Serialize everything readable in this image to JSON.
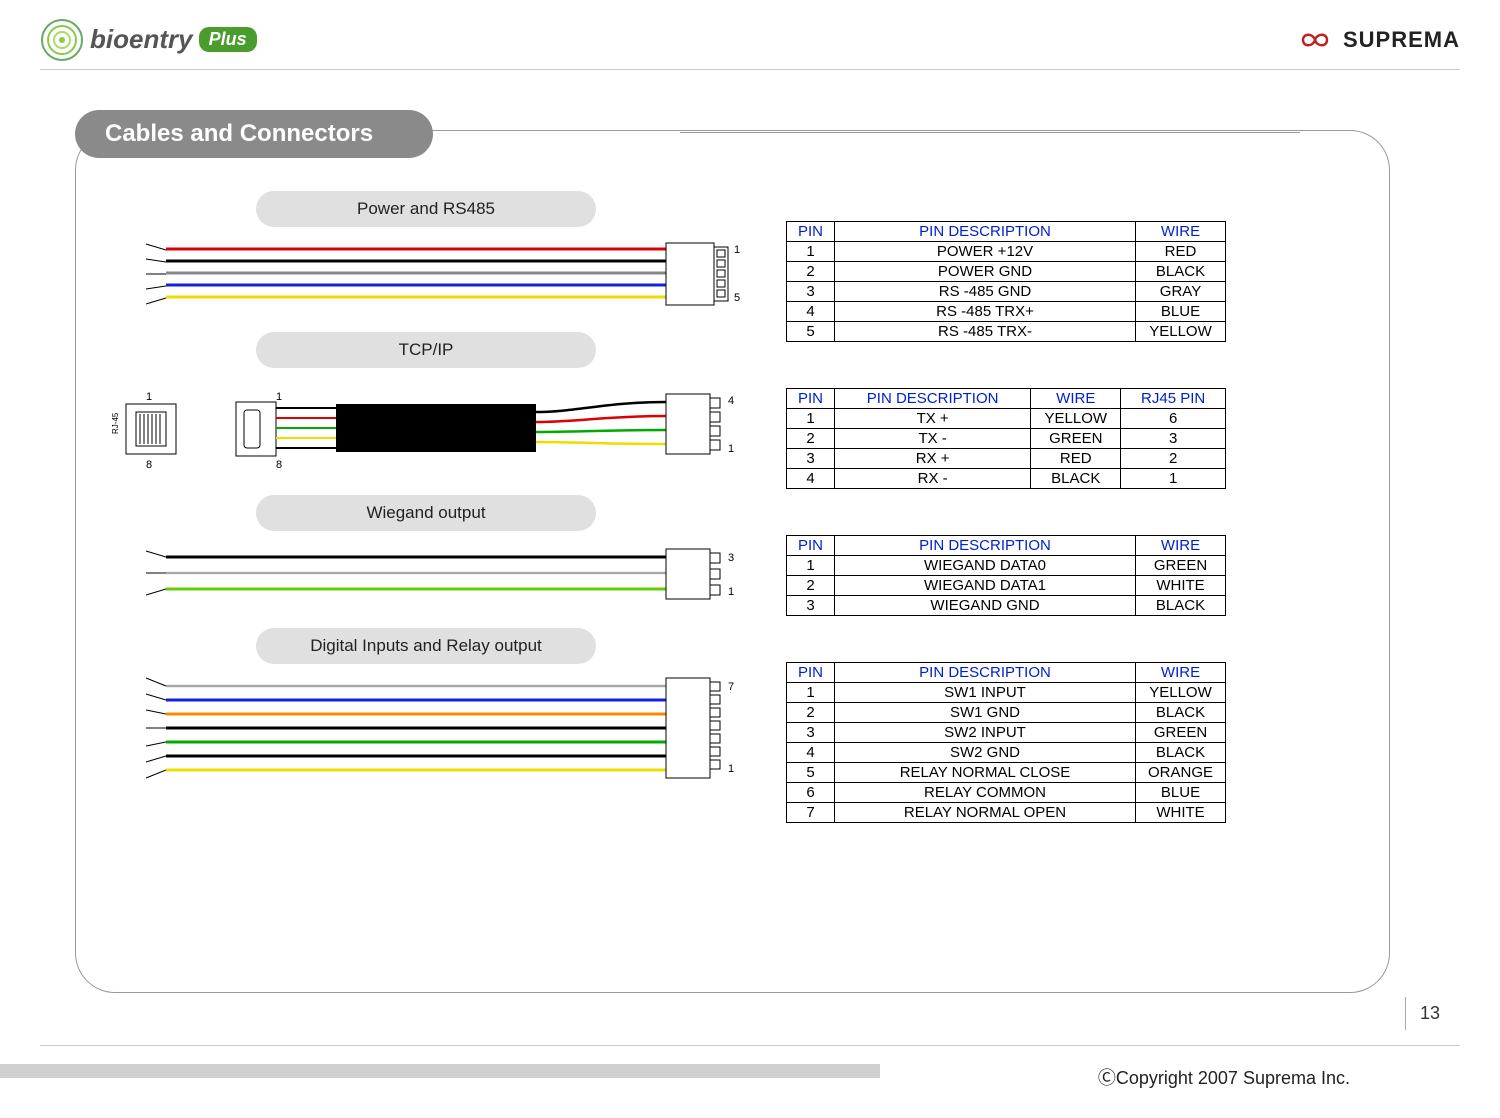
{
  "header": {
    "brand_prefix": "bioentry",
    "brand_badge": "Plus",
    "company": "SUPREMA"
  },
  "section_title": "Cables and Connectors",
  "labels": {
    "power": "Power and RS485",
    "tcpip": "TCP/IP",
    "wiegand": "Wiegand output",
    "digital": "Digital Inputs and Relay output"
  },
  "tables": {
    "headers3": {
      "pin": "PIN",
      "desc": "PIN DESCRIPTION",
      "wire": "WIRE"
    },
    "headers4": {
      "pin": "PIN",
      "desc": "PIN DESCRIPTION",
      "wire": "WIRE",
      "rj": "RJ45 PIN"
    },
    "power": [
      {
        "pin": "1",
        "desc": "POWER +12V",
        "wire": "RED"
      },
      {
        "pin": "2",
        "desc": "POWER GND",
        "wire": "BLACK"
      },
      {
        "pin": "3",
        "desc": "RS -485 GND",
        "wire": "GRAY"
      },
      {
        "pin": "4",
        "desc": "RS -485 TRX+",
        "wire": "BLUE"
      },
      {
        "pin": "5",
        "desc": "RS -485 TRX-",
        "wire": "YELLOW"
      }
    ],
    "tcpip": [
      {
        "pin": "1",
        "desc": "TX +",
        "wire": "YELLOW",
        "rj": "6"
      },
      {
        "pin": "2",
        "desc": "TX -",
        "wire": "GREEN",
        "rj": "3"
      },
      {
        "pin": "3",
        "desc": "RX +",
        "wire": "RED",
        "rj": "2"
      },
      {
        "pin": "4",
        "desc": "RX -",
        "wire": "BLACK",
        "rj": "1"
      }
    ],
    "wiegand": [
      {
        "pin": "1",
        "desc": "WIEGAND DATA0",
        "wire": "GREEN"
      },
      {
        "pin": "2",
        "desc": "WIEGAND DATA1",
        "wire": "WHITE"
      },
      {
        "pin": "3",
        "desc": "WIEGAND GND",
        "wire": "BLACK"
      }
    ],
    "digital": [
      {
        "pin": "1",
        "desc": "SW1 INPUT",
        "wire": "YELLOW"
      },
      {
        "pin": "2",
        "desc": "SW1 GND",
        "wire": "BLACK"
      },
      {
        "pin": "3",
        "desc": "SW2 INPUT",
        "wire": "GREEN"
      },
      {
        "pin": "4",
        "desc": "SW2 GND",
        "wire": "BLACK"
      },
      {
        "pin": "5",
        "desc": "RELAY NORMAL CLOSE",
        "wire": "ORANGE"
      },
      {
        "pin": "6",
        "desc": "RELAY COMMON",
        "wire": "BLUE"
      },
      {
        "pin": "7",
        "desc": "RELAY NORMAL OPEN",
        "wire": "WHITE"
      }
    ]
  },
  "footer": {
    "copyright": "ⒸCopyright 2007 Suprema Inc.",
    "page": "13"
  },
  "diagram": {
    "power_connector": {
      "top_label": "1",
      "bottom_label": "5",
      "wires": [
        "#d00",
        "#000",
        "#888",
        "#12d",
        "#ed0"
      ]
    },
    "tcpip_connector": {
      "left_jack_label": "RJ-45",
      "left_labels_top": "1",
      "left_labels_bottom": "8",
      "mid_labels_top": "1",
      "mid_labels_bottom": "8",
      "right_top": "4",
      "right_bottom": "1",
      "wires_out": [
        "#000",
        "#d00",
        "#0a0",
        "#ed0"
      ]
    },
    "wiegand_connector": {
      "top_label": "3",
      "bottom_label": "1",
      "wires": [
        "#000",
        "#fff",
        "#6c0"
      ]
    },
    "digital_connector": {
      "top_label": "7",
      "bottom_label": "1",
      "wires": [
        "#fff",
        "#12d",
        "#f80",
        "#000",
        "#0a0",
        "#000",
        "#ed0"
      ]
    }
  }
}
